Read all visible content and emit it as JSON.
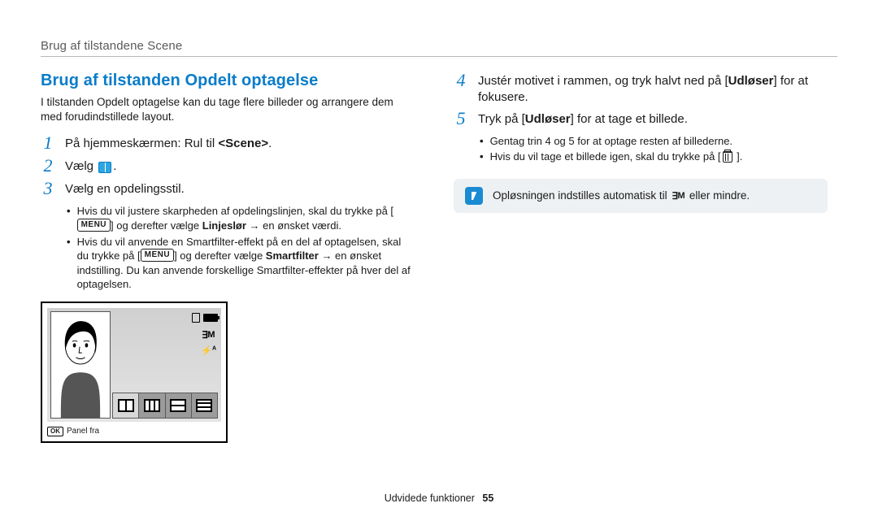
{
  "header": {
    "running_head": "Brug af tilstandene Scene"
  },
  "title": "Brug af tilstanden Opdelt optagelse",
  "intro": "I tilstanden Opdelt optagelse kan du tage flere billeder og arrangere dem med forudindstillede layout.",
  "steps_left": [
    {
      "num": "1",
      "body_prefix": "På hjemmeskærmen: Rul til ",
      "body_bold": "<Scene>",
      "body_suffix": "."
    },
    {
      "num": "2",
      "body_prefix": "Vælg ",
      "body_bold": "",
      "body_suffix": ".",
      "has_split_icon": true
    },
    {
      "num": "3",
      "body_prefix": "Vælg en opdelingsstil.",
      "body_bold": "",
      "body_suffix": ""
    }
  ],
  "bullets_left": [
    {
      "pre": "Hvis du vil justere skarpheden af opdelingslinjen, skal du trykke på [",
      "menu": "MENU",
      "mid": "] og derefter vælge ",
      "bold": "Linjeslør",
      "post": " → en ønsket værdi."
    },
    {
      "pre": "Hvis du vil anvende en Smartfilter-effekt på en del af optagelsen, skal du trykke på [",
      "menu": "MENU",
      "mid": "] og derefter vælge ",
      "bold": "Smartfilter",
      "post": " → en ønsket indstilling. Du kan anvende forskellige Smartfilter-effekter på hver del af optagelsen."
    }
  ],
  "steps_right": [
    {
      "num": "4",
      "body_prefix": "Justér motivet i rammen, og tryk halvt ned på [",
      "body_bold": "Udløser",
      "body_suffix": "] for at fokusere."
    },
    {
      "num": "5",
      "body_prefix": "Tryk på [",
      "body_bold": "Udløser",
      "body_suffix": "] for at tage et billede."
    }
  ],
  "bullets_right": [
    {
      "text": "Gentag trin 4 og 5 for at optage resten af billederne."
    },
    {
      "pre": "Hvis du vil tage et billede igen, skal du trykke på [",
      "post": " ].",
      "has_trash_icon": true
    }
  ],
  "info": {
    "text_pre": "Opløsningen indstilles automatisk til ",
    "res_label": "M",
    "text_post": " eller mindre."
  },
  "lcd": {
    "res_label": "M",
    "flash_label": "A",
    "ok_label": "OK",
    "panel_off": "Panel fra"
  },
  "footer": {
    "section": "Udvidede funktioner",
    "page": "55"
  }
}
